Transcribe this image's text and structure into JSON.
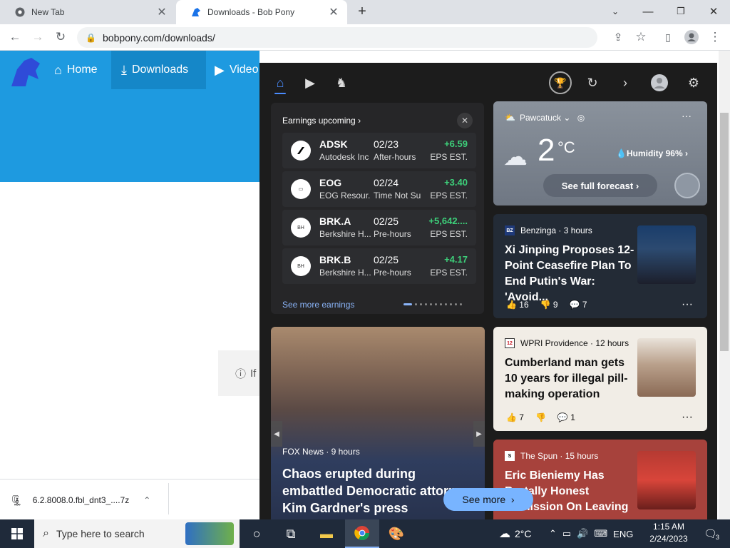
{
  "tabs": [
    {
      "title": "New Tab"
    },
    {
      "title": "Downloads - Bob Pony"
    }
  ],
  "toolbar": {
    "url": "bobpony.com/downloads/"
  },
  "site": {
    "nav": [
      {
        "label": "Home"
      },
      {
        "label": "Downloads"
      },
      {
        "label": "Video"
      }
    ],
    "info_text": "If"
  },
  "download": {
    "filename": "6.2.8008.0.fbl_dnt3_....7z"
  },
  "panel": {
    "earnings": {
      "header": "Earnings upcoming",
      "rows": [
        {
          "symbol": "ADSK",
          "company": "Autodesk Inc",
          "date": "02/23",
          "time": "After-hours",
          "change": "+6.59",
          "eps": "EPS EST."
        },
        {
          "symbol": "EOG",
          "company": "EOG Resour...",
          "date": "02/24",
          "time": "Time Not Su",
          "change": "+3.40",
          "eps": "EPS EST."
        },
        {
          "symbol": "BRK.A",
          "company": "Berkshire H...",
          "date": "02/25",
          "time": "Pre-hours",
          "change": "+5,642....",
          "eps": "EPS EST."
        },
        {
          "symbol": "BRK.B",
          "company": "Berkshire H...",
          "date": "02/25",
          "time": "Pre-hours",
          "change": "+4.17",
          "eps": "EPS EST."
        }
      ],
      "see_more": "See more earnings"
    },
    "weather": {
      "location": "Pawcatuck",
      "temp": "2",
      "unit": "°C",
      "humidity": "Humidity 96%",
      "forecast_button": "See full forecast"
    },
    "news": [
      {
        "source": "Benzinga · 3 hours",
        "logo": "BZ",
        "headline": "Xi Jinping Proposes 12-Point Ceasefire Plan To End Putin's War: 'Avoid...",
        "likes": "16",
        "dislikes": "9",
        "comments": "7"
      },
      {
        "source": "WPRI Providence · 12 hours",
        "logo": "12",
        "headline": "Cumberland man gets 10 years for illegal pill-making operation",
        "likes": "7",
        "dislikes": "",
        "comments": "1"
      },
      {
        "source": "The Spun · 15 hours",
        "logo": "S",
        "headline": "Eric Bieniemy Has Brutally Honest Admission On Leaving ..."
      }
    ],
    "big_story": {
      "source": "FOX News · 9 hours",
      "headline": "Chaos erupted during embattled Democratic attorney Kim Gardner's press conference"
    },
    "see_more_button": "See more"
  },
  "taskbar": {
    "search_placeholder": "Type here to search",
    "weather": "2°C",
    "lang": "ENG",
    "time": "1:15 AM",
    "date": "2/24/2023",
    "notifications": "3"
  }
}
